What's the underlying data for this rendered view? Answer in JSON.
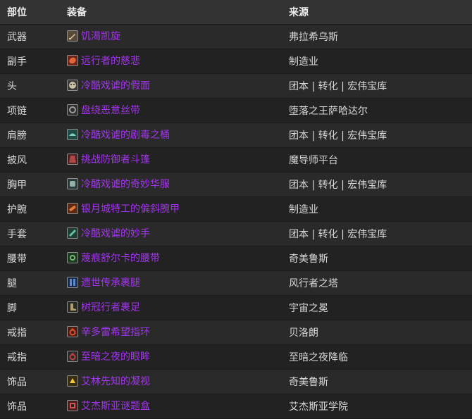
{
  "table": {
    "headers": {
      "slot": "部位",
      "item": "装备",
      "source": "来源"
    },
    "rows": [
      {
        "slot": "武器",
        "item": "饥渴凯旋",
        "source": "弗拉希乌斯",
        "icon": "sword-icon",
        "icon_bg": "#5a4a3a",
        "icon_fg": "#d9c9a8"
      },
      {
        "slot": "副手",
        "item": "远行者的慈悲",
        "source": "制造业",
        "icon": "offhand-icon",
        "icon_bg": "#6a2418",
        "icon_fg": "#e0683a"
      },
      {
        "slot": "头",
        "item": "冷酷戏谑的假面",
        "source": "团本 | 转化 | 宏伟宝库",
        "icon": "mask-icon",
        "icon_bg": "#3a3a38",
        "icon_fg": "#c8c0a8"
      },
      {
        "slot": "项链",
        "item": "盘绕恶意丝带",
        "source": "堕落之王萨哈达尔",
        "icon": "necklace-icon",
        "icon_bg": "#2e2e2e",
        "icon_fg": "#a0a0a0"
      },
      {
        "slot": "肩膀",
        "item": "冷酷戏谑的剧毒之桶",
        "source": "团本 | 转化 | 宏伟宝库",
        "icon": "shoulder-icon",
        "icon_bg": "#1f4a46",
        "icon_fg": "#7fd0c0"
      },
      {
        "slot": "披风",
        "item": "挑战防御者斗篷",
        "source": "魔导师平台",
        "icon": "cloak-icon",
        "icon_bg": "#4a2020",
        "icon_fg": "#b04848"
      },
      {
        "slot": "胸甲",
        "item": "冷酷戏谑的奇妙华服",
        "source": "团本 | 转化 | 宏伟宝库",
        "icon": "chest-icon",
        "icon_bg": "#2a3a3a",
        "icon_fg": "#90b0a8"
      },
      {
        "slot": "护腕",
        "item": "银月城特工的偏斜腕甲",
        "source": "制造业",
        "icon": "bracer-icon",
        "icon_bg": "#5a2a14",
        "icon_fg": "#e07838"
      },
      {
        "slot": "手套",
        "item": "冷酷戏谑的妙手",
        "source": "团本 | 转化 | 宏伟宝库",
        "icon": "gloves-icon",
        "icon_bg": "#1e3e36",
        "icon_fg": "#68c0a0"
      },
      {
        "slot": "腰带",
        "item": "蔑痕舒尔卡的腰带",
        "source": "奇美鲁斯",
        "icon": "belt-icon",
        "icon_bg": "#1e3a22",
        "icon_fg": "#70c070"
      },
      {
        "slot": "腿",
        "item": "遗世传承裹腿",
        "source": "风行者之塔",
        "icon": "legs-icon",
        "icon_bg": "#182a4a",
        "icon_fg": "#5a8ad0"
      },
      {
        "slot": "脚",
        "item": "树冠行者裹足",
        "source": "宇宙之冕",
        "icon": "boots-icon",
        "icon_bg": "#2a2a24",
        "icon_fg": "#b0a070"
      },
      {
        "slot": "戒指",
        "item": "辛多雷希望指环",
        "source": "贝洛朗",
        "icon": "ring-icon",
        "icon_bg": "#4a1c14",
        "icon_fg": "#e05030"
      },
      {
        "slot": "戒指",
        "item": "至暗之夜的眼眸",
        "source": "至暗之夜降临",
        "icon": "ring-icon",
        "icon_bg": "#2a2a2a",
        "icon_fg": "#c04040"
      },
      {
        "slot": "饰品",
        "item": "艾林先知的凝视",
        "source": "奇美鲁斯",
        "icon": "trinket-icon",
        "icon_bg": "#3a2e10",
        "icon_fg": "#f0c840"
      },
      {
        "slot": "饰品",
        "item": "艾杰斯亚谜题盒",
        "source": "艾杰斯亚学院",
        "icon": "puzzle-box-icon",
        "icon_bg": "#4a1c1c",
        "icon_fg": "#d05858"
      }
    ]
  }
}
